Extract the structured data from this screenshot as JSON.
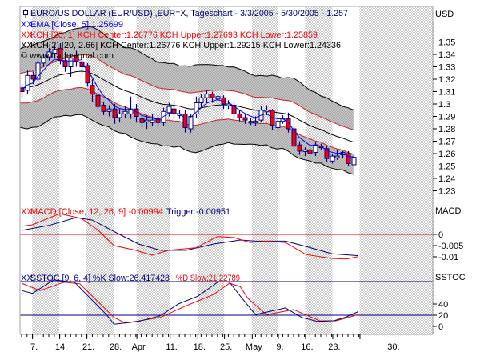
{
  "legend": {
    "title": "EURO/US DOLLAR (EUR/USD) ,EUR=X, Tageschart - 3/3/2005 - 5/30/2005 - 1.257",
    "ema": "EMA [Close, 5]:1.25699",
    "kch1": "KCH [20, 1] KCH Center:1.26776 KCH Upper:1.27693 KCH Lower:1.25859",
    "kch2": "KCH(2) [20, 2.66] KCH Center:1.26776 KCH Upper:1.29215 KCH Lower:1.24336",
    "copyright": "© www.tradesignal.com",
    "macd": "MACD [Close, 12, 26, 9]:-0.00994",
    "trigger": "Trigger:-0.00951",
    "k_slow": "SSTOC [9, 6, 4] %K Slow:26.417428",
    "d_slow": "%D Slow:21.22789",
    "marker": "XX"
  },
  "axis_titles": {
    "price": "USD",
    "macd": "MACD",
    "sstoc": "SSTOC"
  },
  "colors": {
    "up": "#ffffff",
    "down": "#ff0000",
    "outline": "#000080",
    "ema": "#0000ff",
    "band_inner": "#cc2222",
    "band_outer": "#000000",
    "macd": "#ff0000",
    "trigger": "#000080",
    "k": "#000080",
    "d": "#ff0000"
  },
  "chart_data": {
    "type": "candlestick",
    "title": "EURO/US DOLLAR (EUR/USD) ,EUR=X, Tageschart - 3/3/2005 - 5/30/2005 - 1.257",
    "price_ylim": [
      1.22,
      1.36
    ],
    "price_ticks": [
      "1.35",
      "1.34",
      "1.33",
      "1.32",
      "1.31",
      "1.3",
      "1.29",
      "1.28",
      "1.27",
      "1.26",
      "1.25",
      "1.24",
      "1.23"
    ],
    "x_ticks": [
      {
        "label": "7.",
        "i": 2
      },
      {
        "label": "14.",
        "i": 7
      },
      {
        "label": "21.",
        "i": 12
      },
      {
        "label": "28.",
        "i": 17
      },
      {
        "label": "Apr",
        "i": 21.2
      },
      {
        "label": "11.",
        "i": 27.3
      },
      {
        "label": "18.",
        "i": 32.4
      },
      {
        "label": "25.",
        "i": 37.3
      },
      {
        "label": "May",
        "i": 42.4
      },
      {
        "label": "9.",
        "i": 47.2
      },
      {
        "label": "16.",
        "i": 52.2
      },
      {
        "label": "23.",
        "i": 57.2
      },
      {
        "label": "30.",
        "i": 62.2
      }
    ],
    "ohlc": [
      [
        1.313,
        1.316,
        1.305,
        1.31
      ],
      [
        1.311,
        1.327,
        1.308,
        1.323
      ],
      [
        1.323,
        1.326,
        1.316,
        1.32
      ],
      [
        1.32,
        1.335,
        1.318,
        1.333
      ],
      [
        1.333,
        1.34,
        1.33,
        1.337
      ],
      [
        1.338,
        1.345,
        1.335,
        1.342
      ],
      [
        1.341,
        1.348,
        1.337,
        1.344
      ],
      [
        1.345,
        1.349,
        1.332,
        1.335
      ],
      [
        1.335,
        1.338,
        1.326,
        1.33
      ],
      [
        1.33,
        1.34,
        1.322,
        1.337
      ],
      [
        1.339,
        1.343,
        1.33,
        1.334
      ],
      [
        1.334,
        1.338,
        1.324,
        1.33
      ],
      [
        1.331,
        1.333,
        1.314,
        1.317
      ],
      [
        1.315,
        1.32,
        1.302,
        1.308
      ],
      [
        1.307,
        1.31,
        1.295,
        1.298
      ],
      [
        1.299,
        1.302,
        1.291,
        1.294
      ],
      [
        1.294,
        1.299,
        1.29,
        1.296
      ],
      [
        1.296,
        1.3,
        1.284,
        1.289
      ],
      [
        1.289,
        1.296,
        1.285,
        1.292
      ],
      [
        1.292,
        1.298,
        1.289,
        1.294
      ],
      [
        1.292,
        1.306,
        1.288,
        1.296
      ],
      [
        1.296,
        1.3,
        1.285,
        1.29
      ],
      [
        1.288,
        1.292,
        1.281,
        1.285
      ],
      [
        1.286,
        1.291,
        1.28,
        1.287
      ],
      [
        1.285,
        1.292,
        1.282,
        1.287
      ],
      [
        1.288,
        1.291,
        1.283,
        1.285
      ],
      [
        1.285,
        1.297,
        1.282,
        1.294
      ],
      [
        1.293,
        1.301,
        1.29,
        1.298
      ],
      [
        1.296,
        1.303,
        1.288,
        1.292
      ],
      [
        1.292,
        1.295,
        1.288,
        1.292
      ],
      [
        1.292,
        1.295,
        1.277,
        1.281
      ],
      [
        1.28,
        1.292,
        1.277,
        1.29
      ],
      [
        1.292,
        1.306,
        1.289,
        1.301
      ],
      [
        1.301,
        1.308,
        1.297,
        1.305
      ],
      [
        1.305,
        1.311,
        1.301,
        1.308
      ],
      [
        1.308,
        1.31,
        1.301,
        1.305
      ],
      [
        1.304,
        1.308,
        1.3,
        1.306
      ],
      [
        1.305,
        1.307,
        1.296,
        1.3
      ],
      [
        1.3,
        1.303,
        1.296,
        1.3
      ],
      [
        1.299,
        1.302,
        1.288,
        1.292
      ],
      [
        1.292,
        1.295,
        1.286,
        1.289
      ],
      [
        1.289,
        1.292,
        1.284,
        1.287
      ],
      [
        1.286,
        1.289,
        1.283,
        1.286
      ],
      [
        1.285,
        1.29,
        1.282,
        1.286
      ],
      [
        1.287,
        1.298,
        1.285,
        1.295
      ],
      [
        1.295,
        1.299,
        1.291,
        1.295
      ],
      [
        1.295,
        1.296,
        1.279,
        1.283
      ],
      [
        1.281,
        1.289,
        1.278,
        1.286
      ],
      [
        1.286,
        1.291,
        1.284,
        1.288
      ],
      [
        1.288,
        1.293,
        1.277,
        1.28
      ],
      [
        1.28,
        1.282,
        1.265,
        1.266
      ],
      [
        1.267,
        1.27,
        1.259,
        1.262
      ],
      [
        1.262,
        1.265,
        1.258,
        1.263
      ],
      [
        1.263,
        1.265,
        1.259,
        1.26
      ],
      [
        1.261,
        1.269,
        1.258,
        1.267
      ],
      [
        1.266,
        1.268,
        1.263,
        1.265
      ],
      [
        1.264,
        1.266,
        1.253,
        1.256
      ],
      [
        1.254,
        1.26,
        1.252,
        1.258
      ],
      [
        1.257,
        1.263,
        1.255,
        1.258
      ],
      [
        1.259,
        1.262,
        1.256,
        1.261
      ],
      [
        1.26,
        1.262,
        1.25,
        1.252
      ],
      [
        1.251,
        1.259,
        1.25,
        1.257
      ]
    ],
    "macd": {
      "ticks": [
        {
          "label": "0",
          "v": 0
        },
        {
          "label": "-0.005",
          "v": -0.005
        },
        {
          "label": "-0.01",
          "v": -0.01
        }
      ],
      "zero_line": 0,
      "macd_line": [
        [
          0,
          0.0036
        ],
        [
          2,
          0.0043
        ],
        [
          7,
          0.0093
        ],
        [
          11,
          0.0071
        ],
        [
          14,
          0.002
        ],
        [
          17,
          -0.005
        ],
        [
          21,
          -0.0071
        ],
        [
          24,
          -0.0093
        ],
        [
          27,
          -0.0071
        ],
        [
          32,
          -0.006
        ],
        [
          36,
          -0.001
        ],
        [
          39,
          -0.0014
        ],
        [
          42,
          -0.0036
        ],
        [
          45,
          -0.003
        ],
        [
          48.5,
          -0.0036
        ],
        [
          52.3,
          -0.009
        ],
        [
          57,
          -0.0107
        ],
        [
          59.7,
          -0.011
        ],
        [
          61.9,
          -0.00994
        ]
      ],
      "trigger_line": [
        [
          0,
          0.0018
        ],
        [
          5,
          0.004
        ],
        [
          10,
          0.0075
        ],
        [
          13,
          0.0064
        ],
        [
          18,
          0
        ],
        [
          21.5,
          -0.0043
        ],
        [
          25.5,
          -0.0071
        ],
        [
          30.3,
          -0.0071
        ],
        [
          35.3,
          -0.0043
        ],
        [
          40.2,
          -0.0025
        ],
        [
          43,
          -0.003
        ],
        [
          48.5,
          -0.003
        ],
        [
          52.3,
          -0.0054
        ],
        [
          57,
          -0.0086
        ],
        [
          61.9,
          -0.00951
        ]
      ]
    },
    "sstoc": {
      "ticks": [
        {
          "label": "40",
          "v": 40
        },
        {
          "label": "20",
          "v": 20
        },
        {
          "label": "0",
          "v": 0
        }
      ],
      "levels": [
        80,
        20
      ],
      "k_slow": [
        [
          0,
          64
        ],
        [
          2,
          59
        ],
        [
          5.9,
          83
        ],
        [
          9.7,
          79
        ],
        [
          15.6,
          21
        ],
        [
          17,
          4
        ],
        [
          21.5,
          9
        ],
        [
          25.5,
          19
        ],
        [
          28.8,
          40
        ],
        [
          32.4,
          54
        ],
        [
          36.2,
          80
        ],
        [
          38.2,
          79
        ],
        [
          40.2,
          54
        ],
        [
          43,
          21
        ],
        [
          48.5,
          33
        ],
        [
          51.5,
          16
        ],
        [
          54.4,
          9
        ],
        [
          57.4,
          10
        ],
        [
          59.7,
          17
        ],
        [
          61.9,
          26.4
        ]
      ],
      "d_slow": [
        [
          0,
          77
        ],
        [
          3.4,
          64
        ],
        [
          7.8,
          79
        ],
        [
          10.7,
          76
        ],
        [
          17,
          16
        ],
        [
          19.1,
          6
        ],
        [
          25.5,
          16
        ],
        [
          30.3,
          37
        ],
        [
          35.3,
          57
        ],
        [
          38.2,
          77
        ],
        [
          40.2,
          71
        ],
        [
          41.6,
          50
        ],
        [
          45,
          21
        ],
        [
          50,
          30
        ],
        [
          54.8,
          10
        ],
        [
          57.8,
          10
        ],
        [
          61.9,
          21.2
        ]
      ]
    }
  }
}
